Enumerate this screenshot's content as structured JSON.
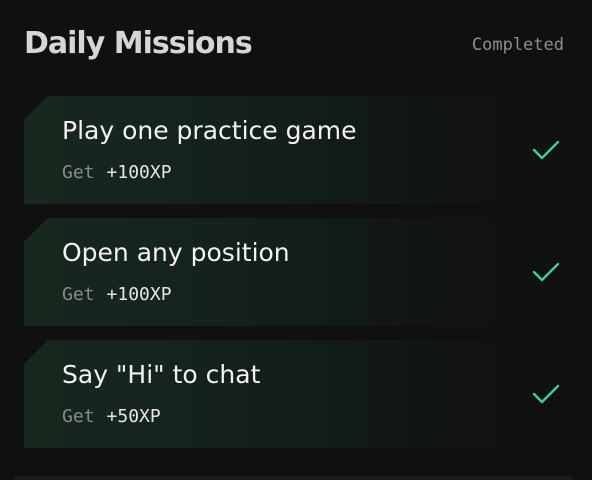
{
  "header": {
    "title": "Daily Missions",
    "status": "Completed"
  },
  "missions": [
    {
      "title": "Play one practice game",
      "reward_label": "Get",
      "reward_value": "+100XP",
      "completed": true
    },
    {
      "title": "Open any position",
      "reward_label": "Get",
      "reward_value": "+100XP",
      "completed": true
    },
    {
      "title": "Say \"Hi\" to chat",
      "reward_label": "Get",
      "reward_value": "+50XP",
      "completed": true
    }
  ],
  "colors": {
    "background": "#101012",
    "card_accent": "#17281f",
    "check": "#3ecf8e",
    "title_text": "#d6d6d6",
    "muted_text": "#8e8e93"
  },
  "icons": {
    "check": "checkmark-icon"
  }
}
